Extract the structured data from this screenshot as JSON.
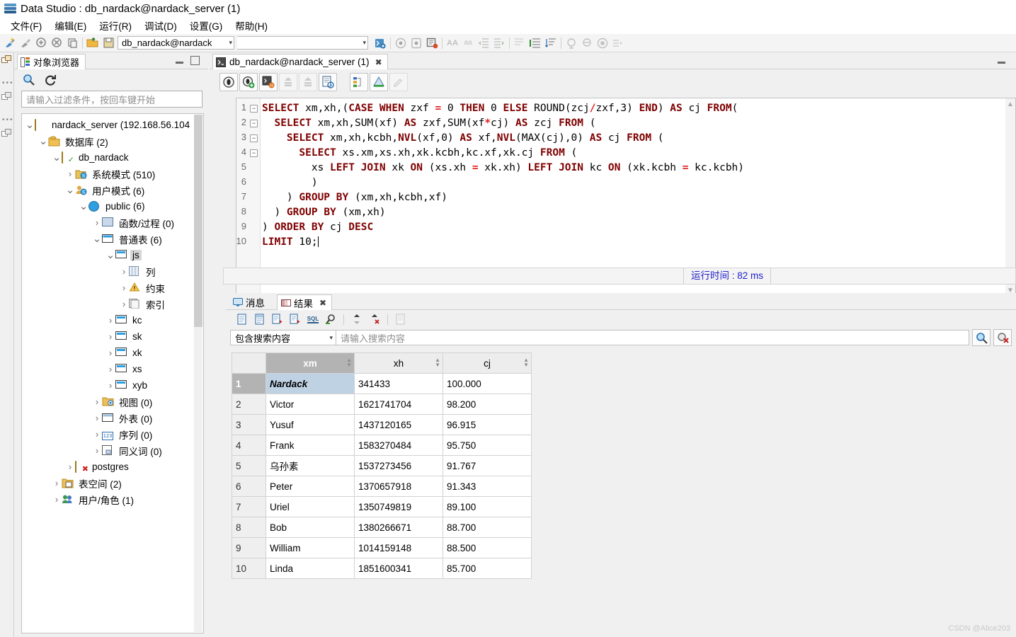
{
  "window": {
    "title": "Data Studio : db_nardack@nardack_server (1)",
    "logo_icon": "data-studio-logo-icon"
  },
  "menubar": {
    "items": [
      {
        "label": "文件(F)",
        "name": "menu-file"
      },
      {
        "label": "编辑(E)",
        "name": "menu-edit"
      },
      {
        "label": "运行(R)",
        "name": "menu-run"
      },
      {
        "label": "调试(D)",
        "name": "menu-debug"
      },
      {
        "label": "设置(G)",
        "name": "menu-settings"
      },
      {
        "label": "帮助(H)",
        "name": "menu-help"
      }
    ]
  },
  "main_toolbar": {
    "connection_value": "db_nardack@nardack",
    "second_combo_value": "",
    "icons": [
      "new-connection-icon",
      "disconnect-icon",
      "import-icon",
      "export-icon",
      "copy-connection-icon",
      "open-file-icon",
      "save-file-icon"
    ],
    "right_icons": [
      "new-sql-terminal-icon",
      "run-icon",
      "run-step-icon",
      "debug-icon",
      "uppercase-icon",
      "lowercase-icon",
      "indent-left-icon",
      "indent-right-icon",
      "comment-icon",
      "format-icon",
      "sort-icon",
      "execute-plan-icon",
      "explain-icon",
      "stop-icon",
      "history-icon"
    ]
  },
  "object_browser": {
    "tab_label": "对象浏览器",
    "tab_icon": "object-browser-icon",
    "search_icon": "search-icon",
    "refresh_icon": "refresh-icon",
    "minimize_icon": "minimize-icon",
    "maximize_icon": "maximize-icon",
    "filter_placeholder": "请输入过滤条件，按回车键开始",
    "tree": [
      {
        "label": "nardack_server (192.168.56.104",
        "indent": 0,
        "twist": "v",
        "icon": "server-icon",
        "selected": false
      },
      {
        "label": "数据库 (2)",
        "indent": 1,
        "twist": "v",
        "icon": "database-folder-icon",
        "selected": false
      },
      {
        "label": "db_nardack",
        "indent": 2,
        "twist": "v",
        "icon": "database-connected-icon",
        "selected": false
      },
      {
        "label": "系统模式 (510)",
        "indent": 3,
        "twist": ">",
        "icon": "system-schema-icon",
        "selected": false
      },
      {
        "label": "用户模式 (6)",
        "indent": 3,
        "twist": "v",
        "icon": "user-schema-icon",
        "selected": false
      },
      {
        "label": "public (6)",
        "indent": 4,
        "twist": "v",
        "icon": "schema-icon",
        "selected": false
      },
      {
        "label": "函数/过程 (0)",
        "indent": 5,
        "twist": ">",
        "icon": "function-icon",
        "selected": false
      },
      {
        "label": "普通表 (6)",
        "indent": 5,
        "twist": "v",
        "icon": "tables-folder-icon",
        "selected": false
      },
      {
        "label": "js",
        "indent": 6,
        "twist": "v",
        "icon": "table-icon",
        "selected": true
      },
      {
        "label": "列",
        "indent": 7,
        "twist": ">",
        "icon": "columns-icon",
        "selected": false
      },
      {
        "label": "约束",
        "indent": 7,
        "twist": ">",
        "icon": "constraint-icon",
        "selected": false
      },
      {
        "label": "索引",
        "indent": 7,
        "twist": ">",
        "icon": "index-icon",
        "selected": false
      },
      {
        "label": "kc",
        "indent": 6,
        "twist": ">",
        "icon": "table-icon",
        "selected": false
      },
      {
        "label": "sk",
        "indent": 6,
        "twist": ">",
        "icon": "table-icon",
        "selected": false
      },
      {
        "label": "xk",
        "indent": 6,
        "twist": ">",
        "icon": "table-icon",
        "selected": false
      },
      {
        "label": "xs",
        "indent": 6,
        "twist": ">",
        "icon": "table-icon",
        "selected": false
      },
      {
        "label": "xyb",
        "indent": 6,
        "twist": ">",
        "icon": "table-icon",
        "selected": false
      },
      {
        "label": "视图 (0)",
        "indent": 5,
        "twist": ">",
        "icon": "views-folder-icon",
        "selected": false
      },
      {
        "label": "外表 (0)",
        "indent": 5,
        "twist": ">",
        "icon": "foreign-tables-icon",
        "selected": false
      },
      {
        "label": "序列 (0)",
        "indent": 5,
        "twist": ">",
        "icon": "sequences-icon",
        "selected": false
      },
      {
        "label": "同义词 (0)",
        "indent": 5,
        "twist": ">",
        "icon": "synonyms-icon",
        "selected": false
      },
      {
        "label": "postgres",
        "indent": 3,
        "twist": ">",
        "icon": "database-disconnected-icon",
        "selected": false
      },
      {
        "label": "表空间 (2)",
        "indent": 2,
        "twist": ">",
        "icon": "tablespace-icon",
        "selected": false
      },
      {
        "label": "用户/角色 (1)",
        "indent": 2,
        "twist": ">",
        "icon": "users-roles-icon",
        "selected": false
      }
    ]
  },
  "editor": {
    "tab_label": "db_nardack@nardack_server (1)",
    "tab_icon": "sql-terminal-icon",
    "tab_close_icon": "close-icon",
    "minimize_icon": "minimize-icon",
    "toolbar_icons": [
      "execute-icon",
      "execute-and-keep-icon",
      "execute-history-icon",
      "commit-icon",
      "rollback-icon",
      "sql-history-icon",
      "explain-plan-icon",
      "visual-explain-icon",
      "edit-icon"
    ],
    "sql_lines": [
      {
        "n": 1,
        "fold": true,
        "text": "SELECT xm,xh,(CASE WHEN zxf = 0 THEN 0 ELSE ROUND(zcj/zxf,3) END) AS cj FROM("
      },
      {
        "n": 2,
        "fold": true,
        "text": "  SELECT xm,xh,SUM(xf) AS zxf,SUM(xf*cj) AS zcj FROM ("
      },
      {
        "n": 3,
        "fold": true,
        "text": "    SELECT xm,xh,kcbh,NVL(xf,0) AS xf,NVL(MAX(cj),0) AS cj FROM ("
      },
      {
        "n": 4,
        "fold": true,
        "text": "      SELECT xs.xm,xs.xh,xk.kcbh,kc.xf,xk.cj FROM ("
      },
      {
        "n": 5,
        "fold": false,
        "text": "        xs LEFT JOIN xk ON (xs.xh = xk.xh) LEFT JOIN kc ON (xk.kcbh = kc.kcbh)"
      },
      {
        "n": 6,
        "fold": false,
        "text": "        )"
      },
      {
        "n": 7,
        "fold": false,
        "text": "    ) GROUP BY (xm,xh,kcbh,xf)"
      },
      {
        "n": 8,
        "fold": false,
        "text": "  ) GROUP BY (xm,xh)"
      },
      {
        "n": 9,
        "fold": false,
        "text": ") ORDER BY cj DESC"
      },
      {
        "n": 10,
        "fold": false,
        "text": "LIMIT 10;"
      }
    ]
  },
  "status_bar": {
    "run_time_label": "运行时间 : 82 ms"
  },
  "results": {
    "tabs": [
      {
        "label": "消息",
        "icon": "messages-icon",
        "active": false,
        "closable": false
      },
      {
        "label": "结果",
        "icon": "results-icon",
        "active": true,
        "closable": true
      }
    ],
    "close_icon": "close-icon",
    "toolbar_icons": [
      "copy-icon",
      "copy-with-header-icon",
      "export-sql-insert-icon",
      "export-sql-delete-icon",
      "generate-sql-icon",
      "find-icon",
      "sort-asc-icon",
      "clear-sort-icon",
      "copy-grid-icon"
    ],
    "search_mode": "包含搜索内容",
    "search_placeholder": "请输入搜索内容",
    "search_button_icon": "search-icon",
    "clear_search_button_icon": "clear-search-icon",
    "columns": [
      "xm",
      "xh",
      "cj"
    ],
    "rows": [
      {
        "n": "1",
        "xm": "Nardack",
        "xh": "341433",
        "cj": "100.000"
      },
      {
        "n": "2",
        "xm": "Victor",
        "xh": "1621741704",
        "cj": "98.200"
      },
      {
        "n": "3",
        "xm": "Yusuf",
        "xh": "1437120165",
        "cj": "96.915"
      },
      {
        "n": "4",
        "xm": "Frank",
        "xh": "1583270484",
        "cj": "95.750"
      },
      {
        "n": "5",
        "xm": "乌孙素",
        "xh": "1537273456",
        "cj": "91.767"
      },
      {
        "n": "6",
        "xm": "Peter",
        "xh": "1370657918",
        "cj": "91.343"
      },
      {
        "n": "7",
        "xm": "Uriel",
        "xh": "1350749819",
        "cj": "89.100"
      },
      {
        "n": "8",
        "xm": "Bob",
        "xh": "1380266671",
        "cj": "88.700"
      },
      {
        "n": "9",
        "xm": "William",
        "xh": "1014159148",
        "cj": "88.500"
      },
      {
        "n": "10",
        "xm": "Linda",
        "xh": "1851600341",
        "cj": "85.700"
      }
    ],
    "selected_row_index": 0,
    "selected_column": "xm"
  },
  "watermark": "CSDN @Alice203",
  "colors": {
    "keyword": "#7f0000",
    "operator": "#e01b1b",
    "status_text": "#2222cc",
    "selection": "#bed2e4"
  }
}
